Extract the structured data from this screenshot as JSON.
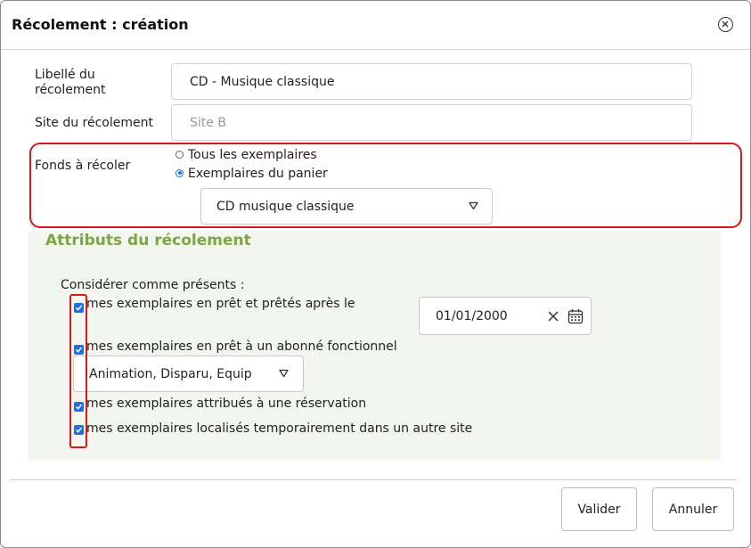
{
  "dialog": {
    "title": "Récolement : création",
    "close_icon": "circle-x-icon"
  },
  "form": {
    "libelle_label": "Libellé du récolement",
    "libelle_value": "CD - Musique classique",
    "site_label": "Site du récolement",
    "site_placeholder": "Site B",
    "fonds_label": "Fonds à récoler",
    "fonds_options": [
      {
        "label": "Tous les exemplaires",
        "checked": false
      },
      {
        "label": "Exemplaires du panier",
        "checked": true
      }
    ],
    "panier_selected": "CD musique classique"
  },
  "attributes": {
    "title": "Attributs du récolement",
    "intro": "Considérer comme présents :",
    "items": [
      {
        "label": "mes exemplaires en prêt et prêtés après le",
        "checked": true
      },
      {
        "label": "mes exemplaires en prêt à un abonné fonctionnel",
        "checked": true
      },
      {
        "label": "mes exemplaires attribués à une réservation",
        "checked": true
      },
      {
        "label": "mes exemplaires localisés temporairement dans un autre site",
        "checked": true
      }
    ],
    "date_value": "01/01/2000",
    "abonne_selected": "Animation, Disparu, Equip"
  },
  "footer": {
    "validate_label": "Valider",
    "cancel_label": "Annuler"
  },
  "colors": {
    "accent": "#1e6fe0",
    "highlight": "#d9171c",
    "section_title": "#7da545",
    "section_bg": "#f3f6ee"
  }
}
